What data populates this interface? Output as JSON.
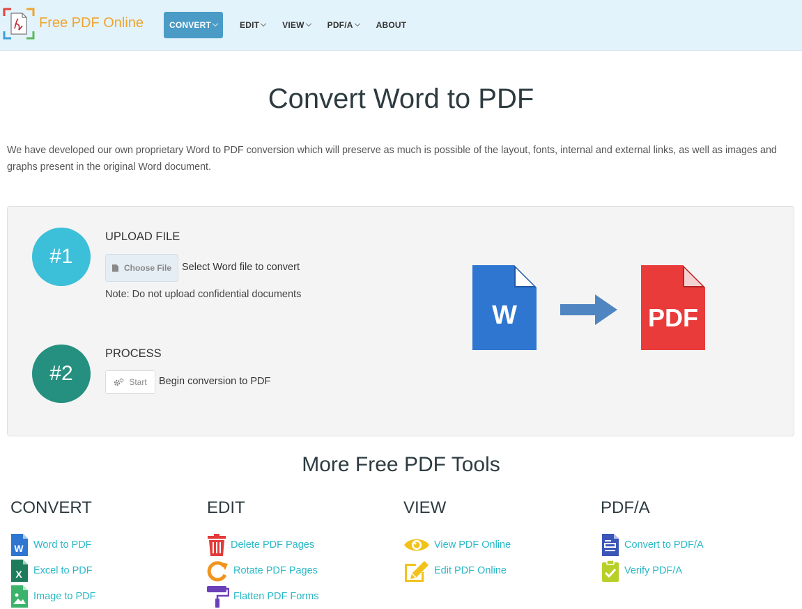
{
  "header": {
    "brand": "Free PDF Online",
    "nav": [
      {
        "label": "CONVERT",
        "active": true,
        "has_caret": true
      },
      {
        "label": "EDIT",
        "has_caret": true
      },
      {
        "label": "VIEW",
        "has_caret": true
      },
      {
        "label": "PDF/A",
        "has_caret": true
      },
      {
        "label": "ABOUT",
        "has_caret": false
      }
    ]
  },
  "page": {
    "title": "Convert Word to PDF",
    "intro": "We have developed our own proprietary Word to PDF conversion which will preserve as much is possible of the layout, fonts, internal and external links, as well as images and graphs present in the original Word document."
  },
  "converter": {
    "step1": {
      "badge": "#1",
      "heading": "UPLOAD FILE",
      "button": "Choose File",
      "hint": "Select Word file to convert",
      "note": "Note: Do not upload confidential documents"
    },
    "step2": {
      "badge": "#2",
      "heading": "PROCESS",
      "button": "Start",
      "hint": "Begin conversion to PDF"
    },
    "illustration": {
      "word_letter": "W",
      "pdf_label": "PDF"
    }
  },
  "more": {
    "title": "More Free PDF Tools",
    "columns": [
      {
        "heading": "CONVERT",
        "tools": [
          {
            "label": "Word to PDF",
            "icon": "word-doc-icon"
          },
          {
            "label": "Excel to PDF",
            "icon": "excel-doc-icon"
          },
          {
            "label": "Image to PDF",
            "icon": "image-doc-icon"
          }
        ]
      },
      {
        "heading": "EDIT",
        "tools": [
          {
            "label": "Delete PDF Pages",
            "icon": "trash-icon"
          },
          {
            "label": "Rotate PDF Pages",
            "icon": "rotate-icon"
          },
          {
            "label": "Flatten PDF Forms",
            "icon": "paint-roller-icon"
          }
        ]
      },
      {
        "heading": "VIEW",
        "tools": [
          {
            "label": "View PDF Online",
            "icon": "eye-icon"
          },
          {
            "label": "Edit PDF Online",
            "icon": "pencil-edit-icon"
          }
        ]
      },
      {
        "heading": "PDF/A",
        "tools": [
          {
            "label": "Convert to PDF/A",
            "icon": "pdfa-doc-icon"
          },
          {
            "label": "Verify PDF/A",
            "icon": "clipboard-check-icon"
          }
        ]
      }
    ]
  },
  "colors": {
    "header_bg": "#e3f3fc",
    "nav_active": "#4a9cc7",
    "brand": "#f0a42b",
    "step1_circle": "#3cbfd8",
    "step2_circle": "#25907f",
    "link": "#28b8c6",
    "word_blue": "#2f76d1",
    "pdf_red": "#ea3b3b",
    "arrow": "#4f86c1"
  }
}
